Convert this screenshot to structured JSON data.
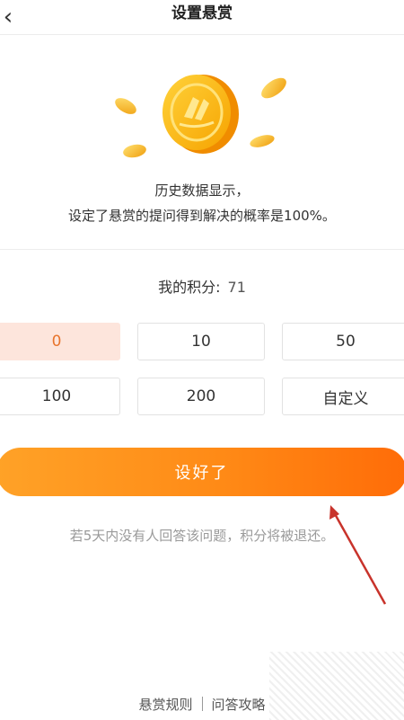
{
  "header": {
    "back_icon": "‹",
    "title": "设置悬赏"
  },
  "history": {
    "line1": "历史数据显示，",
    "line2": "设定了悬赏的提问得到解决的概率是100%。"
  },
  "points": {
    "label": "我的积分:",
    "value": "71"
  },
  "options": [
    "0",
    "10",
    "50",
    "100",
    "200",
    "自定义"
  ],
  "selected_option": "0",
  "submit_label": "设好了",
  "notice": "若5天内没有人回答该问题，积分将被退还。",
  "footer": {
    "rules_link": "悬赏规则",
    "guide_link": "问答攻略"
  },
  "colors": {
    "accent": "#ff8a16",
    "selected_bg": "#fde5dc",
    "selected_text": "#e8742c",
    "coin": "#f7b916",
    "annotation_arrow": "#c8332b"
  }
}
